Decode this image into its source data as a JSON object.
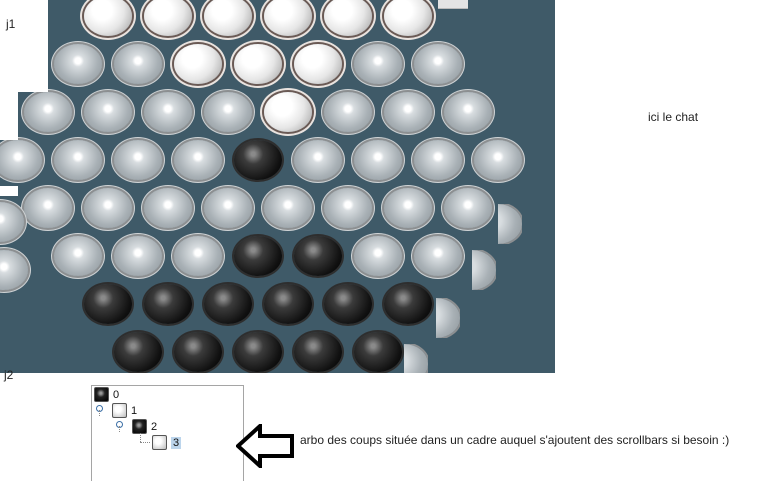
{
  "labels": {
    "player1": "j1",
    "player2": "j2",
    "chat_placeholder": "ici le chat",
    "tree_note": "arbo des coups située dans un cadre auquel s'ajoutent des scrollbars si besoin :)"
  },
  "board": {
    "background_color": "#3f5a68",
    "rows": [
      [
        "white",
        "white",
        "white",
        "white",
        "white",
        "white"
      ],
      [
        "empty",
        "empty",
        "white",
        "white",
        "white",
        "empty",
        "empty"
      ],
      [
        "empty",
        "empty",
        "empty",
        "empty",
        "white",
        "empty",
        "empty",
        "empty"
      ],
      [
        "empty",
        "empty",
        "empty",
        "empty",
        "black",
        "empty",
        "empty",
        "empty",
        "empty"
      ],
      [
        "empty",
        "empty",
        "empty",
        "empty",
        "empty",
        "empty",
        "empty",
        "empty"
      ],
      [
        "empty",
        "empty",
        "empty",
        "black",
        "black",
        "empty",
        "empty"
      ],
      [
        "black",
        "black",
        "black",
        "black",
        "black",
        "black"
      ],
      [
        "black",
        "black",
        "black",
        "black",
        "black"
      ]
    ]
  },
  "move_tree": {
    "nodes": [
      {
        "label": "0",
        "marble": "black",
        "selected": false
      },
      {
        "label": "1",
        "marble": "white",
        "selected": false
      },
      {
        "label": "2",
        "marble": "black",
        "selected": false
      },
      {
        "label": "3",
        "marble": "white",
        "selected": true
      }
    ]
  }
}
